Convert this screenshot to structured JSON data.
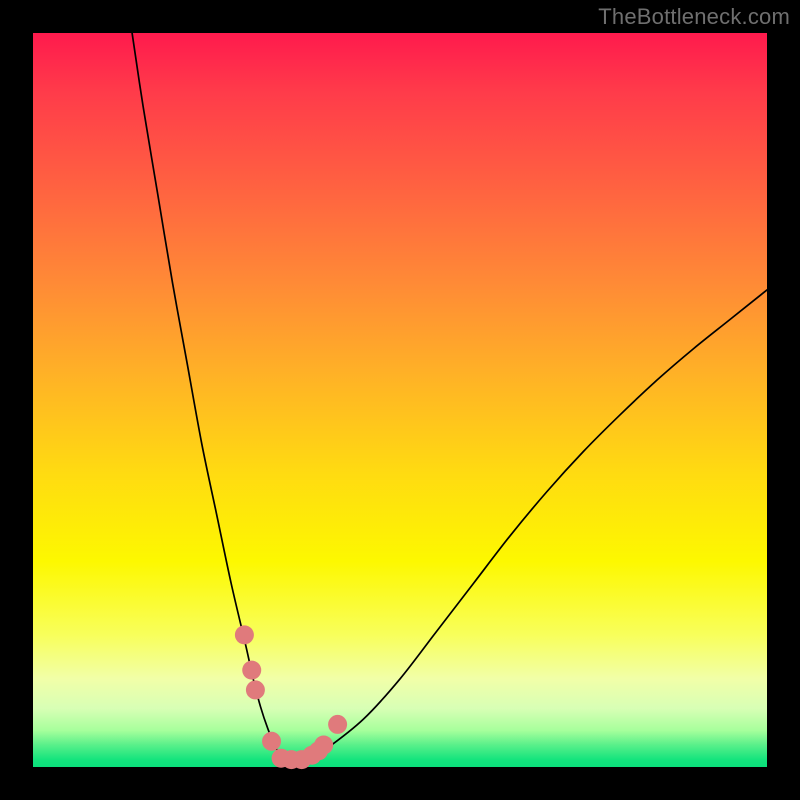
{
  "watermark_text": "TheBottleneck.com",
  "chart_data": {
    "type": "line",
    "title": "",
    "xlabel": "",
    "ylabel": "",
    "xlim": [
      0,
      100
    ],
    "ylim": [
      0,
      100
    ],
    "grid": false,
    "legend": false,
    "background_gradient": {
      "orientation": "vertical",
      "stops": [
        {
          "pos": 0,
          "color": "#ff1a4d"
        },
        {
          "pos": 50,
          "color": "#ffd313"
        },
        {
          "pos": 80,
          "color": "#f6ff74"
        },
        {
          "pos": 100,
          "color": "#0be07c"
        }
      ]
    },
    "series": [
      {
        "name": "bottleneck-curve",
        "x": [
          13.5,
          15,
          17,
          19,
          21,
          23,
          25,
          27,
          29,
          30,
          31,
          32,
          33,
          34.2,
          36,
          38,
          40,
          45,
          50,
          55,
          60,
          65,
          70,
          75,
          80,
          85,
          90,
          95,
          100
        ],
        "y": [
          100,
          90,
          78,
          66,
          55,
          44,
          34.5,
          25,
          16.5,
          12,
          8.2,
          5.2,
          2.8,
          1,
          1,
          1.4,
          2.5,
          6.5,
          12,
          18.5,
          25,
          31.5,
          37.5,
          43,
          48,
          52.7,
          57,
          61,
          65
        ]
      }
    ],
    "markers": [
      {
        "name": "left-dot-upper",
        "x": 28.8,
        "y": 18.0
      },
      {
        "name": "left-dot-mid",
        "x": 29.8,
        "y": 13.2
      },
      {
        "name": "left-dot-lower",
        "x": 30.3,
        "y": 10.5
      },
      {
        "name": "trough-left",
        "x": 32.5,
        "y": 3.5
      },
      {
        "name": "trough-center-1",
        "x": 33.8,
        "y": 1.2
      },
      {
        "name": "trough-center-2",
        "x": 35.2,
        "y": 1.0
      },
      {
        "name": "trough-center-3",
        "x": 36.6,
        "y": 1.0
      },
      {
        "name": "trough-right-1",
        "x": 38.0,
        "y": 1.6
      },
      {
        "name": "trough-right-2",
        "x": 38.9,
        "y": 2.2
      },
      {
        "name": "right-dot-low",
        "x": 39.6,
        "y": 3.0
      },
      {
        "name": "right-dot-high",
        "x": 41.5,
        "y": 5.8
      }
    ],
    "marker_style": {
      "radius_px": 9.5,
      "color": "#e07a7c"
    }
  }
}
